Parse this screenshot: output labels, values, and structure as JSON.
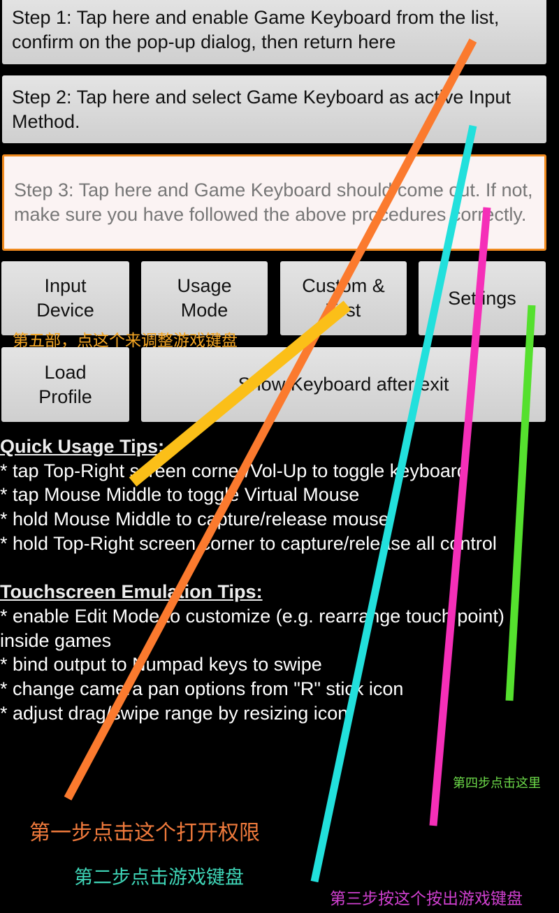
{
  "steps": [
    "Step 1: Tap here and enable Game Keyboard from the list, confirm on the pop-up dialog, then return here",
    "Step 2: Tap here and select Game Keyboard as active Input Method.",
    "Step 3: Tap here and Game Keyboard should come out. If not, make sure you have followed the above procedures correctly."
  ],
  "buttons": {
    "input_device": "Input Device",
    "usage_mode": "Usage Mode",
    "custom_test": "Custom & Test",
    "settings": "Settings",
    "load_profile": "Load Profile",
    "show_keyboard": "Show Keyboard after exit"
  },
  "quick_tips": {
    "title": "Quick Usage Tips:",
    "items": [
      "* tap Top-Right screen corner/Vol-Up to toggle keyboard",
      "* tap Mouse Middle to toggle Virtual Mouse",
      "* hold Mouse Middle to capture/release mouse",
      "* hold Top-Right screen corner to capture/release all control"
    ]
  },
  "touch_tips": {
    "title": "Touchscreen Emulation Tips:",
    "items": [
      "* enable Edit Mode to customize (e.g. rearrange touch point)\ninside games",
      "* bind output to Numpad keys to swipe",
      "* change camera pan options from \"R\" stick icon",
      "* adjust drag/swipe range by resizing icon"
    ]
  },
  "annotations": {
    "step1": {
      "text": "第一步点击这个打开权限",
      "color": "#f07a3c"
    },
    "step2": {
      "text": "第二步点击游戏键盘",
      "color": "#3fd6b8"
    },
    "step3": {
      "text": "第三步按这个按出游戏键盘",
      "color": "#d040d0"
    },
    "step4": {
      "text": "第四步点击这里",
      "color": "#6ddc4a"
    },
    "step5": {
      "text": "第五部，点这个来调整游戏键盘",
      "color": "#f5a623"
    }
  }
}
